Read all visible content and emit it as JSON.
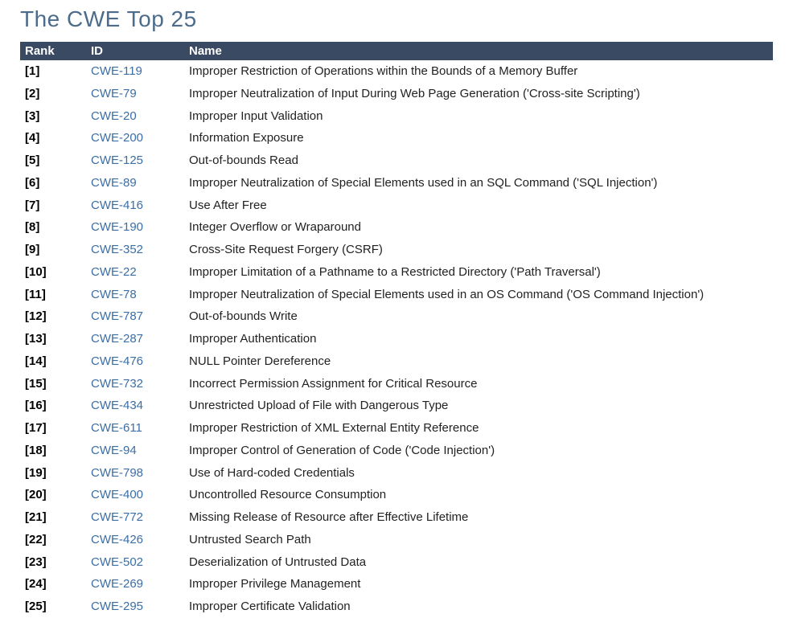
{
  "title": "The CWE Top 25",
  "table": {
    "headers": {
      "rank": "Rank",
      "id": "ID",
      "name": "Name"
    },
    "rows": [
      {
        "rank": "[1]",
        "id": "CWE-119",
        "name": "Improper Restriction of Operations within the Bounds of a Memory Buffer"
      },
      {
        "rank": "[2]",
        "id": "CWE-79",
        "name": "Improper Neutralization of Input During Web Page Generation ('Cross-site Scripting')"
      },
      {
        "rank": "[3]",
        "id": "CWE-20",
        "name": "Improper Input Validation"
      },
      {
        "rank": "[4]",
        "id": "CWE-200",
        "name": "Information Exposure"
      },
      {
        "rank": "[5]",
        "id": "CWE-125",
        "name": "Out-of-bounds Read"
      },
      {
        "rank": "[6]",
        "id": "CWE-89",
        "name": "Improper Neutralization of Special Elements used in an SQL Command ('SQL Injection')"
      },
      {
        "rank": "[7]",
        "id": "CWE-416",
        "name": "Use After Free"
      },
      {
        "rank": "[8]",
        "id": "CWE-190",
        "name": "Integer Overflow or Wraparound"
      },
      {
        "rank": "[9]",
        "id": "CWE-352",
        "name": "Cross-Site Request Forgery (CSRF)"
      },
      {
        "rank": "[10]",
        "id": "CWE-22",
        "name": "Improper Limitation of a Pathname to a Restricted Directory ('Path Traversal')"
      },
      {
        "rank": "[11]",
        "id": "CWE-78",
        "name": "Improper Neutralization of Special Elements used in an OS Command ('OS Command Injection')"
      },
      {
        "rank": "[12]",
        "id": "CWE-787",
        "name": "Out-of-bounds Write"
      },
      {
        "rank": "[13]",
        "id": "CWE-287",
        "name": "Improper Authentication"
      },
      {
        "rank": "[14]",
        "id": "CWE-476",
        "name": "NULL Pointer Dereference"
      },
      {
        "rank": "[15]",
        "id": "CWE-732",
        "name": "Incorrect Permission Assignment for Critical Resource"
      },
      {
        "rank": "[16]",
        "id": "CWE-434",
        "name": "Unrestricted Upload of File with Dangerous Type"
      },
      {
        "rank": "[17]",
        "id": "CWE-611",
        "name": "Improper Restriction of XML External Entity Reference"
      },
      {
        "rank": "[18]",
        "id": "CWE-94",
        "name": "Improper Control of Generation of Code ('Code Injection')"
      },
      {
        "rank": "[19]",
        "id": "CWE-798",
        "name": "Use of Hard-coded Credentials"
      },
      {
        "rank": "[20]",
        "id": "CWE-400",
        "name": "Uncontrolled Resource Consumption"
      },
      {
        "rank": "[21]",
        "id": "CWE-772",
        "name": "Missing Release of Resource after Effective Lifetime"
      },
      {
        "rank": "[22]",
        "id": "CWE-426",
        "name": "Untrusted Search Path"
      },
      {
        "rank": "[23]",
        "id": "CWE-502",
        "name": "Deserialization of Untrusted Data"
      },
      {
        "rank": "[24]",
        "id": "CWE-269",
        "name": "Improper Privilege Management"
      },
      {
        "rank": "[25]",
        "id": "CWE-295",
        "name": "Improper Certificate Validation"
      }
    ]
  }
}
